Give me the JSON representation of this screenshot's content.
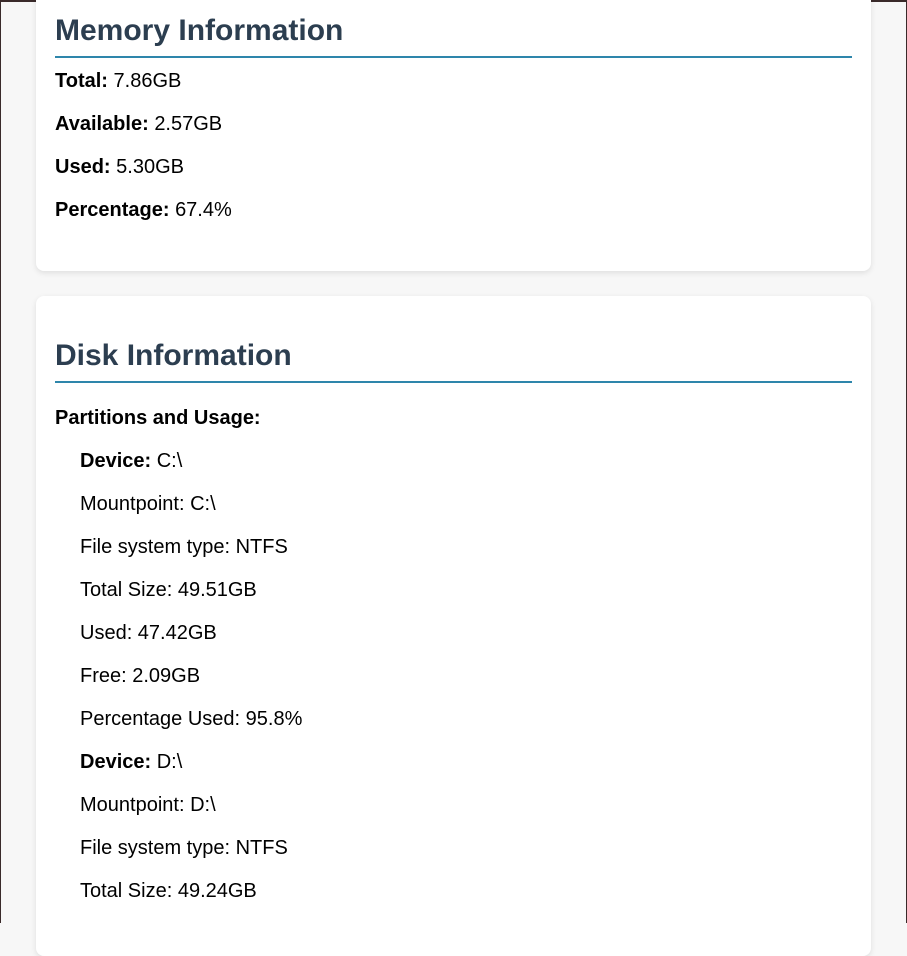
{
  "memory": {
    "heading": "Memory Information",
    "rows": [
      {
        "label": "Total:",
        "value": "7.86GB"
      },
      {
        "label": "Available:",
        "value": "2.57GB"
      },
      {
        "label": "Used:",
        "value": "5.30GB"
      },
      {
        "label": "Percentage:",
        "value": "67.4%"
      }
    ]
  },
  "disk": {
    "heading": "Disk Information",
    "partitions_label": "Partitions and Usage:",
    "partitions": [
      {
        "device_label": "Device:",
        "device": "C:\\",
        "mountpoint": "Mountpoint: C:\\",
        "fstype": "File system type: NTFS",
        "total": "Total Size: 49.51GB",
        "used": "Used: 47.42GB",
        "free": "Free: 2.09GB",
        "percent": "Percentage Used: 95.8%"
      },
      {
        "device_label": "Device:",
        "device": "D:\\",
        "mountpoint": "Mountpoint: D:\\",
        "fstype": "File system type: NTFS",
        "total": "Total Size: 49.24GB"
      }
    ]
  },
  "colors": {
    "heading": "#2c3e50",
    "heading_rule": "#2e86ab",
    "page_background": "#f7f7f7",
    "card_background": "#ffffff"
  }
}
